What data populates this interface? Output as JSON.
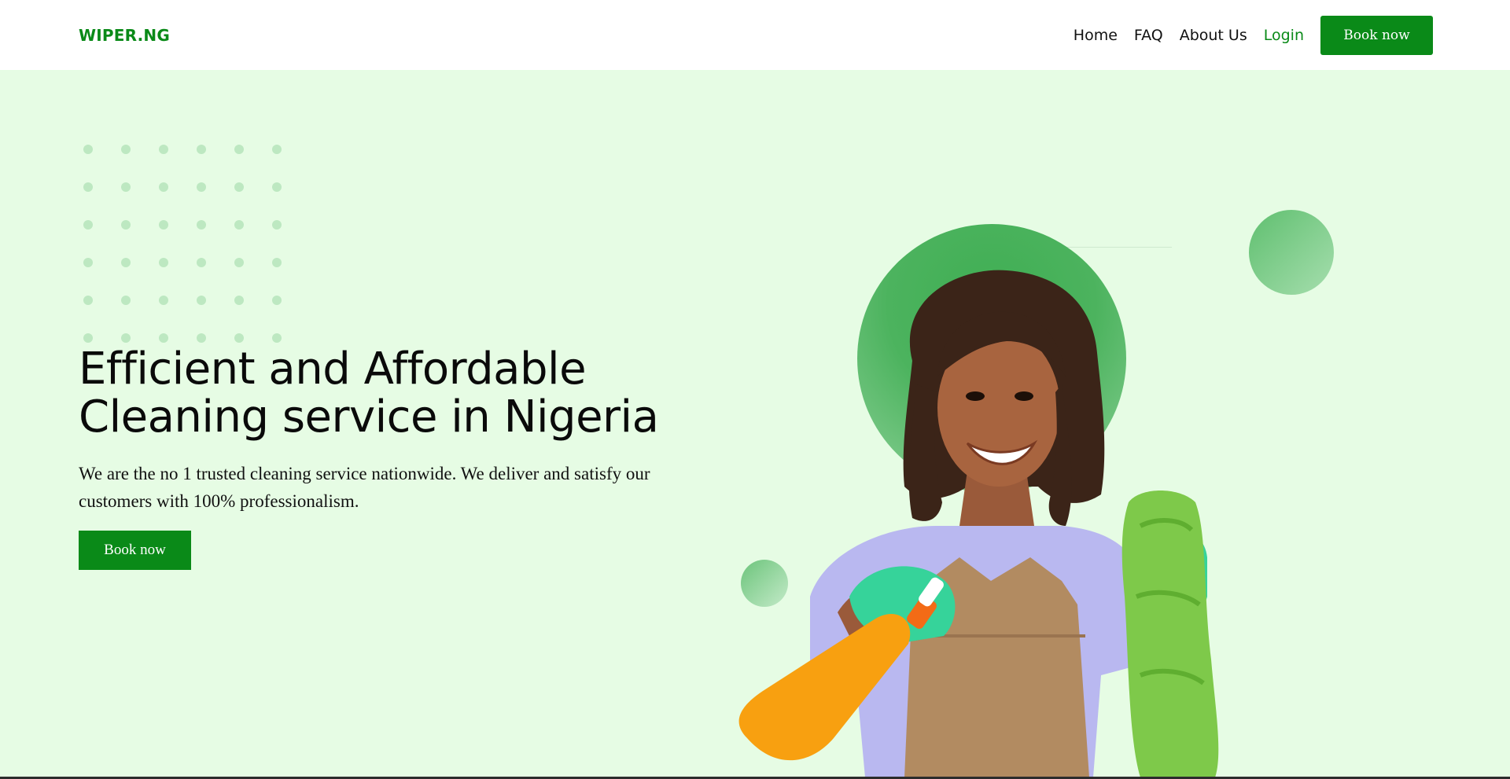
{
  "header": {
    "logo": "WIPER.NG",
    "nav": {
      "home": "Home",
      "faq": "FAQ",
      "about": "About Us",
      "login": "Login",
      "book": "Book now"
    }
  },
  "hero": {
    "title_line1": "Efficient and Affordable",
    "title_line2": "Cleaning service in Nigeria",
    "subtitle": "We are the no 1 trusted cleaning service nationwide. We deliver and satisfy our customers with 100% professionalism.",
    "cta": "Book now"
  },
  "colors": {
    "brand_green": "#0a8a18",
    "hero_background": "#e6fce4",
    "dot_color": "#bde8c1"
  },
  "icons": {
    "hero_image": "cleaning-woman-illustration"
  }
}
